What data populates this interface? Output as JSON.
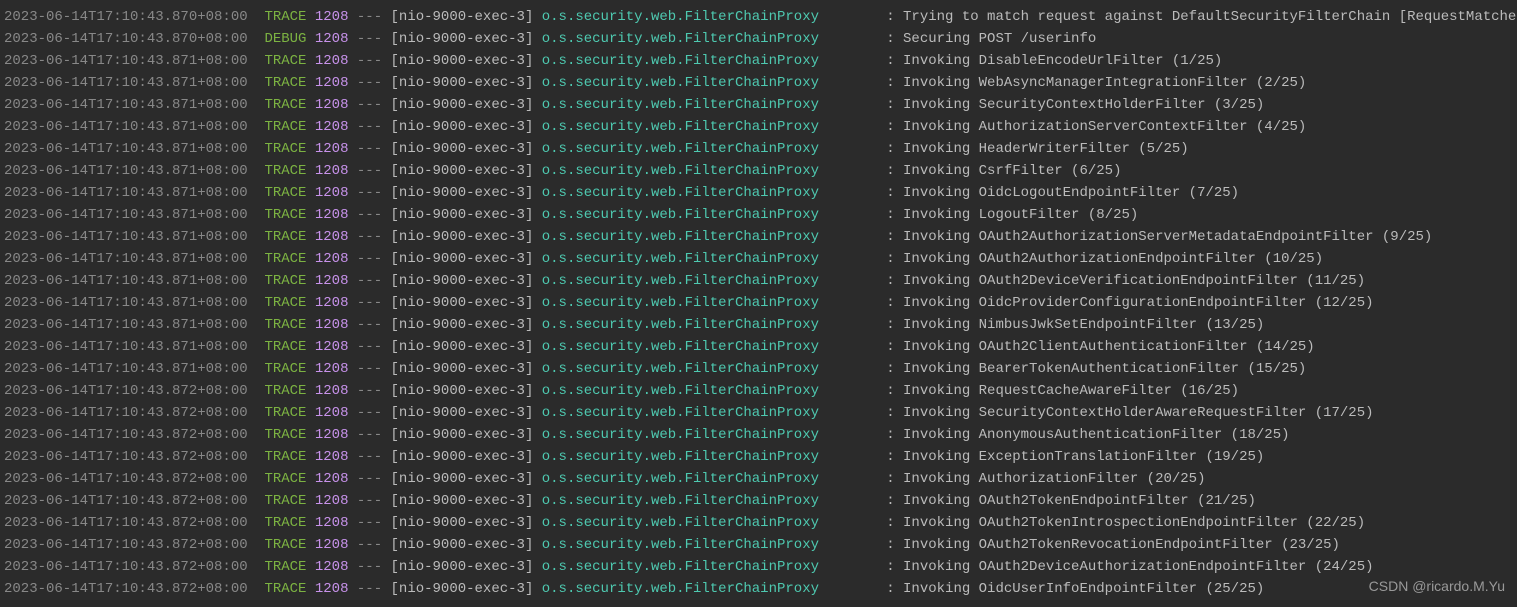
{
  "watermark": "CSDN @ricardo.M.Yu",
  "separator": "---",
  "logs": [
    {
      "timestamp": "2023-06-14T17:10:43.870+08:00",
      "level": "TRACE",
      "pid": "1208",
      "thread": "[nio-9000-exec-3]",
      "logger": "o.s.security.web.FilterChainProxy",
      "message": "Trying to match request against DefaultSecurityFilterChain [RequestMatcher=org.sprin"
    },
    {
      "timestamp": "2023-06-14T17:10:43.870+08:00",
      "level": "DEBUG",
      "pid": "1208",
      "thread": "[nio-9000-exec-3]",
      "logger": "o.s.security.web.FilterChainProxy",
      "message": "Securing POST /userinfo"
    },
    {
      "timestamp": "2023-06-14T17:10:43.871+08:00",
      "level": "TRACE",
      "pid": "1208",
      "thread": "[nio-9000-exec-3]",
      "logger": "o.s.security.web.FilterChainProxy",
      "message": "Invoking DisableEncodeUrlFilter (1/25)"
    },
    {
      "timestamp": "2023-06-14T17:10:43.871+08:00",
      "level": "TRACE",
      "pid": "1208",
      "thread": "[nio-9000-exec-3]",
      "logger": "o.s.security.web.FilterChainProxy",
      "message": "Invoking WebAsyncManagerIntegrationFilter (2/25)"
    },
    {
      "timestamp": "2023-06-14T17:10:43.871+08:00",
      "level": "TRACE",
      "pid": "1208",
      "thread": "[nio-9000-exec-3]",
      "logger": "o.s.security.web.FilterChainProxy",
      "message": "Invoking SecurityContextHolderFilter (3/25)"
    },
    {
      "timestamp": "2023-06-14T17:10:43.871+08:00",
      "level": "TRACE",
      "pid": "1208",
      "thread": "[nio-9000-exec-3]",
      "logger": "o.s.security.web.FilterChainProxy",
      "message": "Invoking AuthorizationServerContextFilter (4/25)"
    },
    {
      "timestamp": "2023-06-14T17:10:43.871+08:00",
      "level": "TRACE",
      "pid": "1208",
      "thread": "[nio-9000-exec-3]",
      "logger": "o.s.security.web.FilterChainProxy",
      "message": "Invoking HeaderWriterFilter (5/25)"
    },
    {
      "timestamp": "2023-06-14T17:10:43.871+08:00",
      "level": "TRACE",
      "pid": "1208",
      "thread": "[nio-9000-exec-3]",
      "logger": "o.s.security.web.FilterChainProxy",
      "message": "Invoking CsrfFilter (6/25)"
    },
    {
      "timestamp": "2023-06-14T17:10:43.871+08:00",
      "level": "TRACE",
      "pid": "1208",
      "thread": "[nio-9000-exec-3]",
      "logger": "o.s.security.web.FilterChainProxy",
      "message": "Invoking OidcLogoutEndpointFilter (7/25)"
    },
    {
      "timestamp": "2023-06-14T17:10:43.871+08:00",
      "level": "TRACE",
      "pid": "1208",
      "thread": "[nio-9000-exec-3]",
      "logger": "o.s.security.web.FilterChainProxy",
      "message": "Invoking LogoutFilter (8/25)"
    },
    {
      "timestamp": "2023-06-14T17:10:43.871+08:00",
      "level": "TRACE",
      "pid": "1208",
      "thread": "[nio-9000-exec-3]",
      "logger": "o.s.security.web.FilterChainProxy",
      "message": "Invoking OAuth2AuthorizationServerMetadataEndpointFilter (9/25)"
    },
    {
      "timestamp": "2023-06-14T17:10:43.871+08:00",
      "level": "TRACE",
      "pid": "1208",
      "thread": "[nio-9000-exec-3]",
      "logger": "o.s.security.web.FilterChainProxy",
      "message": "Invoking OAuth2AuthorizationEndpointFilter (10/25)"
    },
    {
      "timestamp": "2023-06-14T17:10:43.871+08:00",
      "level": "TRACE",
      "pid": "1208",
      "thread": "[nio-9000-exec-3]",
      "logger": "o.s.security.web.FilterChainProxy",
      "message": "Invoking OAuth2DeviceVerificationEndpointFilter (11/25)"
    },
    {
      "timestamp": "2023-06-14T17:10:43.871+08:00",
      "level": "TRACE",
      "pid": "1208",
      "thread": "[nio-9000-exec-3]",
      "logger": "o.s.security.web.FilterChainProxy",
      "message": "Invoking OidcProviderConfigurationEndpointFilter (12/25)"
    },
    {
      "timestamp": "2023-06-14T17:10:43.871+08:00",
      "level": "TRACE",
      "pid": "1208",
      "thread": "[nio-9000-exec-3]",
      "logger": "o.s.security.web.FilterChainProxy",
      "message": "Invoking NimbusJwkSetEndpointFilter (13/25)"
    },
    {
      "timestamp": "2023-06-14T17:10:43.871+08:00",
      "level": "TRACE",
      "pid": "1208",
      "thread": "[nio-9000-exec-3]",
      "logger": "o.s.security.web.FilterChainProxy",
      "message": "Invoking OAuth2ClientAuthenticationFilter (14/25)"
    },
    {
      "timestamp": "2023-06-14T17:10:43.871+08:00",
      "level": "TRACE",
      "pid": "1208",
      "thread": "[nio-9000-exec-3]",
      "logger": "o.s.security.web.FilterChainProxy",
      "message": "Invoking BearerTokenAuthenticationFilter (15/25)"
    },
    {
      "timestamp": "2023-06-14T17:10:43.872+08:00",
      "level": "TRACE",
      "pid": "1208",
      "thread": "[nio-9000-exec-3]",
      "logger": "o.s.security.web.FilterChainProxy",
      "message": "Invoking RequestCacheAwareFilter (16/25)"
    },
    {
      "timestamp": "2023-06-14T17:10:43.872+08:00",
      "level": "TRACE",
      "pid": "1208",
      "thread": "[nio-9000-exec-3]",
      "logger": "o.s.security.web.FilterChainProxy",
      "message": "Invoking SecurityContextHolderAwareRequestFilter (17/25)"
    },
    {
      "timestamp": "2023-06-14T17:10:43.872+08:00",
      "level": "TRACE",
      "pid": "1208",
      "thread": "[nio-9000-exec-3]",
      "logger": "o.s.security.web.FilterChainProxy",
      "message": "Invoking AnonymousAuthenticationFilter (18/25)"
    },
    {
      "timestamp": "2023-06-14T17:10:43.872+08:00",
      "level": "TRACE",
      "pid": "1208",
      "thread": "[nio-9000-exec-3]",
      "logger": "o.s.security.web.FilterChainProxy",
      "message": "Invoking ExceptionTranslationFilter (19/25)"
    },
    {
      "timestamp": "2023-06-14T17:10:43.872+08:00",
      "level": "TRACE",
      "pid": "1208",
      "thread": "[nio-9000-exec-3]",
      "logger": "o.s.security.web.FilterChainProxy",
      "message": "Invoking AuthorizationFilter (20/25)"
    },
    {
      "timestamp": "2023-06-14T17:10:43.872+08:00",
      "level": "TRACE",
      "pid": "1208",
      "thread": "[nio-9000-exec-3]",
      "logger": "o.s.security.web.FilterChainProxy",
      "message": "Invoking OAuth2TokenEndpointFilter (21/25)"
    },
    {
      "timestamp": "2023-06-14T17:10:43.872+08:00",
      "level": "TRACE",
      "pid": "1208",
      "thread": "[nio-9000-exec-3]",
      "logger": "o.s.security.web.FilterChainProxy",
      "message": "Invoking OAuth2TokenIntrospectionEndpointFilter (22/25)"
    },
    {
      "timestamp": "2023-06-14T17:10:43.872+08:00",
      "level": "TRACE",
      "pid": "1208",
      "thread": "[nio-9000-exec-3]",
      "logger": "o.s.security.web.FilterChainProxy",
      "message": "Invoking OAuth2TokenRevocationEndpointFilter (23/25)"
    },
    {
      "timestamp": "2023-06-14T17:10:43.872+08:00",
      "level": "TRACE",
      "pid": "1208",
      "thread": "[nio-9000-exec-3]",
      "logger": "o.s.security.web.FilterChainProxy",
      "message": "Invoking OAuth2DeviceAuthorizationEndpointFilter (24/25)"
    },
    {
      "timestamp": "2023-06-14T17:10:43.872+08:00",
      "level": "TRACE",
      "pid": "1208",
      "thread": "[nio-9000-exec-3]",
      "logger": "o.s.security.web.FilterChainProxy",
      "message": "Invoking OidcUserInfoEndpointFilter (25/25)"
    }
  ]
}
